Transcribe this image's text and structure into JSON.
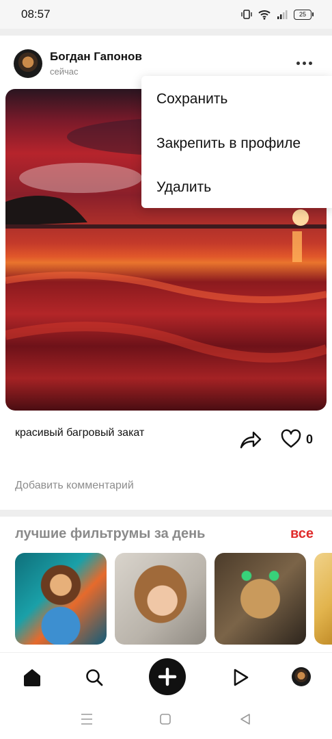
{
  "status_bar": {
    "time": "08:57",
    "battery": "25"
  },
  "post": {
    "author": "Богдан Гапонов",
    "time": "сейчас",
    "caption": "красивый багровый закат",
    "likes": "0",
    "comment_placeholder": "Добавить комментарий"
  },
  "menu": {
    "items": [
      "Сохранить",
      "Закрепить в профиле",
      "Удалить"
    ]
  },
  "best": {
    "title": "лучшие фильтрумы за день",
    "all_label": "все"
  },
  "colors": {
    "accent_red": "#e02b2b"
  },
  "icons": [
    "vibrate-icon",
    "wifi-icon",
    "signal-icon",
    "battery-icon",
    "more-icon",
    "share-icon",
    "heart-icon",
    "home-icon",
    "search-icon",
    "plus-icon",
    "play-icon"
  ]
}
